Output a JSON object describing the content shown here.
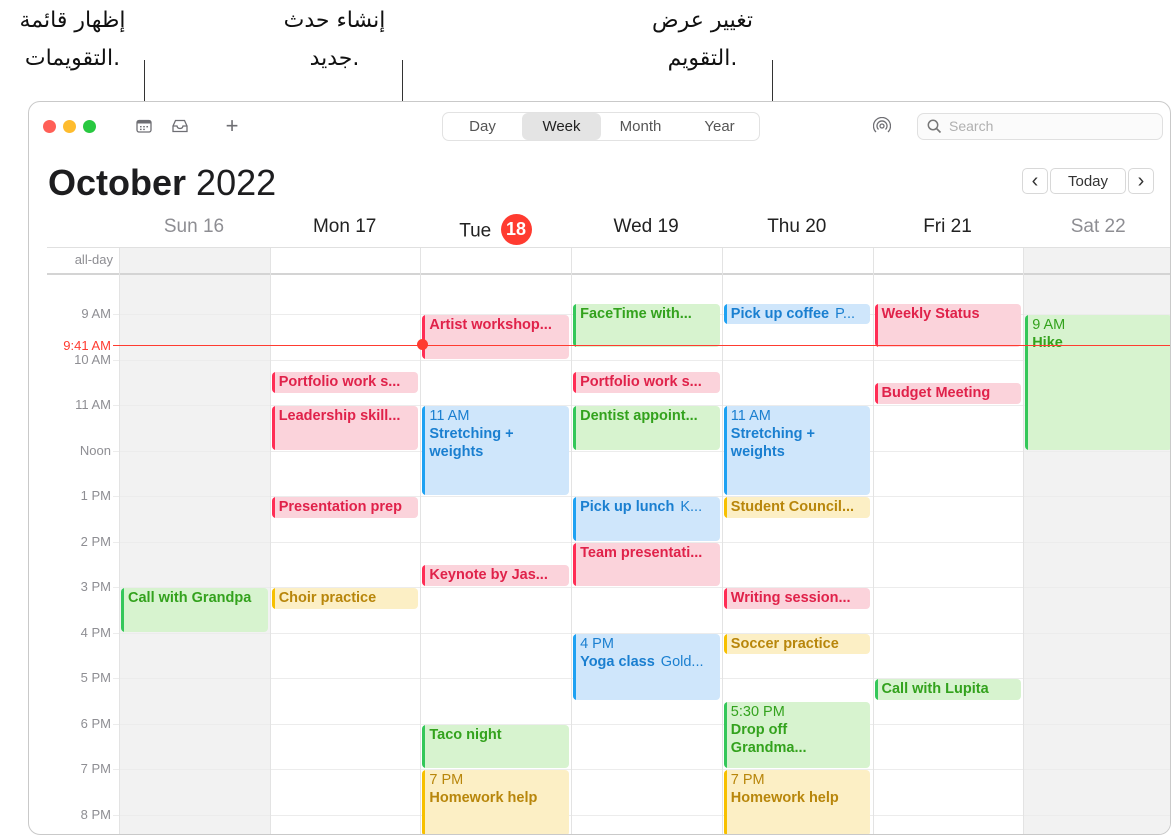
{
  "callouts": {
    "show_calendars": [
      "إظهار قائمة",
      "التقويمات."
    ],
    "new_event": [
      "إنشاء حدث",
      "جديد."
    ],
    "change_view": [
      "تغيير عرض",
      "التقويم."
    ]
  },
  "toolbar": {
    "views": [
      "Day",
      "Week",
      "Month",
      "Year"
    ],
    "selected_view": "Week",
    "search_placeholder": "Search",
    "add_label": "+"
  },
  "header": {
    "month": "October",
    "year": "2022",
    "today_button": "Today",
    "prev": "‹",
    "next": "›"
  },
  "days": [
    {
      "name": "Sun",
      "num": "16",
      "weekend": true
    },
    {
      "name": "Mon",
      "num": "17"
    },
    {
      "name": "Tue",
      "num": "18",
      "today": true
    },
    {
      "name": "Wed",
      "num": "19"
    },
    {
      "name": "Thu",
      "num": "20"
    },
    {
      "name": "Fri",
      "num": "21"
    },
    {
      "name": "Sat",
      "num": "22",
      "weekend": true
    }
  ],
  "all_day_label": "all-day",
  "time_labels": [
    "9 AM",
    "10 AM",
    "11 AM",
    "Noon",
    "1 PM",
    "2 PM",
    "3 PM",
    "4 PM",
    "5 PM",
    "6 PM",
    "7 PM",
    "8 PM"
  ],
  "current_time": "9:41 AM",
  "colors": {
    "red": "#ff2d55",
    "green": "#34c759",
    "blue": "#1ea1f2",
    "yellow": "#f7c000",
    "today": "#ff3b30"
  },
  "events": [
    {
      "day": 1,
      "start": 10.25,
      "end": 10.75,
      "color": "red",
      "title": "Portfolio work s..."
    },
    {
      "day": 1,
      "start": 11.0,
      "end": 12.0,
      "color": "red",
      "title": "Leadership skill..."
    },
    {
      "day": 1,
      "start": 13.0,
      "end": 13.5,
      "color": "red",
      "title": "Presentation prep"
    },
    {
      "day": 1,
      "start": 15.0,
      "end": 15.5,
      "color": "yellow",
      "title": "Choir practice"
    },
    {
      "day": 0,
      "start": 15.0,
      "end": 16.0,
      "color": "green",
      "title": "Call with Grandpa"
    },
    {
      "day": 2,
      "start": 9.0,
      "end": 10.0,
      "color": "red",
      "title": "Artist workshop..."
    },
    {
      "day": 2,
      "start": 11.0,
      "end": 13.0,
      "color": "blue",
      "time": "11 AM",
      "title": "Stretching + weights",
      "wrap": true
    },
    {
      "day": 2,
      "start": 14.5,
      "end": 15.0,
      "color": "red",
      "title": "Keynote by Jas..."
    },
    {
      "day": 2,
      "start": 18.0,
      "end": 19.0,
      "color": "green",
      "title": "Taco night"
    },
    {
      "day": 2,
      "start": 19.0,
      "end": 20.5,
      "color": "yellow",
      "time": "7 PM",
      "title": "Homework help"
    },
    {
      "day": 3,
      "start": 8.75,
      "end": 9.75,
      "color": "green",
      "title": "FaceTime with..."
    },
    {
      "day": 3,
      "start": 10.25,
      "end": 10.75,
      "color": "red",
      "title": "Portfolio work s..."
    },
    {
      "day": 3,
      "start": 11.0,
      "end": 12.0,
      "color": "green",
      "title": "Dentist appoint..."
    },
    {
      "day": 3,
      "start": 13.0,
      "end": 14.0,
      "color": "blue",
      "title": "Pick up lunch",
      "location": "K...",
      "inline": true
    },
    {
      "day": 3,
      "start": 14.0,
      "end": 15.0,
      "color": "red",
      "title": "Team presentati..."
    },
    {
      "day": 3,
      "start": 16.0,
      "end": 17.5,
      "color": "blue",
      "time": "4 PM",
      "title": "Yoga class",
      "location": "Gold...",
      "inline": true
    },
    {
      "day": 4,
      "start": 8.75,
      "end": 9.25,
      "color": "blue",
      "title": "Pick up coffee",
      "location": "P...",
      "inline": true
    },
    {
      "day": 4,
      "start": 11.0,
      "end": 13.0,
      "color": "blue",
      "time": "11 AM",
      "title": "Stretching + weights",
      "wrap": true
    },
    {
      "day": 4,
      "start": 13.0,
      "end": 13.5,
      "color": "yellow",
      "title": "Student Council..."
    },
    {
      "day": 4,
      "start": 15.0,
      "end": 15.5,
      "color": "red",
      "title": "Writing session..."
    },
    {
      "day": 4,
      "start": 16.0,
      "end": 16.5,
      "color": "yellow",
      "title": "Soccer practice"
    },
    {
      "day": 4,
      "start": 17.5,
      "end": 19.0,
      "color": "green",
      "time": "5:30 PM",
      "title": "Drop off Grandma...",
      "wrap": true
    },
    {
      "day": 4,
      "start": 19.0,
      "end": 20.5,
      "color": "yellow",
      "time": "7 PM",
      "title": "Homework help"
    },
    {
      "day": 5,
      "start": 8.75,
      "end": 9.75,
      "color": "red",
      "title": "Weekly Status"
    },
    {
      "day": 5,
      "start": 10.5,
      "end": 11.0,
      "color": "red",
      "title": "Budget Meeting"
    },
    {
      "day": 5,
      "start": 17.0,
      "end": 17.5,
      "color": "green",
      "title": "Call with Lupita"
    },
    {
      "day": 6,
      "start": 9.0,
      "end": 12.0,
      "color": "green",
      "time": "9 AM",
      "title": "Hike"
    }
  ]
}
